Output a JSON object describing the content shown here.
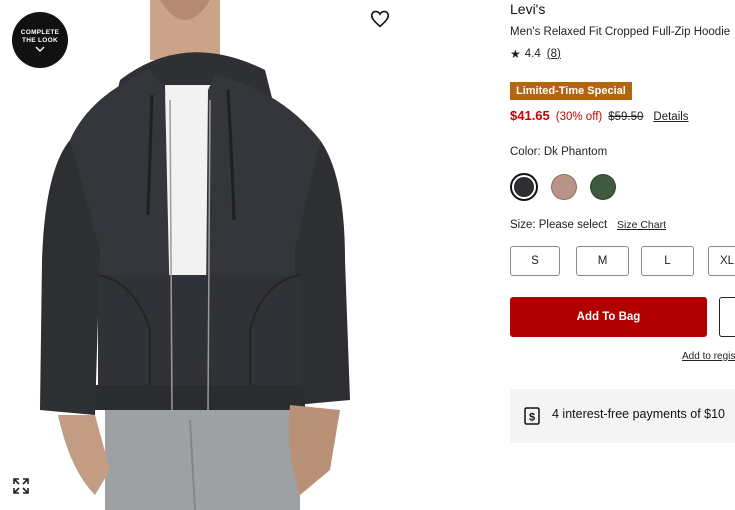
{
  "media": {
    "complete_look_line1": "COMPLETE",
    "complete_look_line2": "THE LOOK",
    "icons": [
      "heart-icon",
      "expand-icon",
      "chevron-down-icon"
    ]
  },
  "product": {
    "brand": "Levi's",
    "name": "Men's Relaxed Fit Cropped Full-Zip Hoodie",
    "rating": "4.4",
    "review_count": "8",
    "promo_badge": "Limited-Time Special",
    "price_sale": "$41.65",
    "price_off": "(30% off)",
    "price_original": "$59.50",
    "details_link": "Details"
  },
  "color": {
    "label": "Color: Dk Phantom",
    "swatches": [
      {
        "name": "Dk Phantom",
        "hex": "#2d2f33"
      },
      {
        "name": "Taupe",
        "hex": "#b89486"
      },
      {
        "name": "Green",
        "hex": "#3f5a41"
      }
    ]
  },
  "size": {
    "label": "Size: Please select",
    "chart_link": "Size Chart",
    "options": [
      "S",
      "M",
      "L",
      "XL"
    ]
  },
  "actions": {
    "add_to_bag": "Add To Bag",
    "registry_link": "Add to regis"
  },
  "payment": {
    "text": "4 interest-free payments of $10"
  },
  "colors": {
    "sale_red": "#cc0000",
    "button_red": "#b10000",
    "badge_gold": "#b5650d"
  }
}
